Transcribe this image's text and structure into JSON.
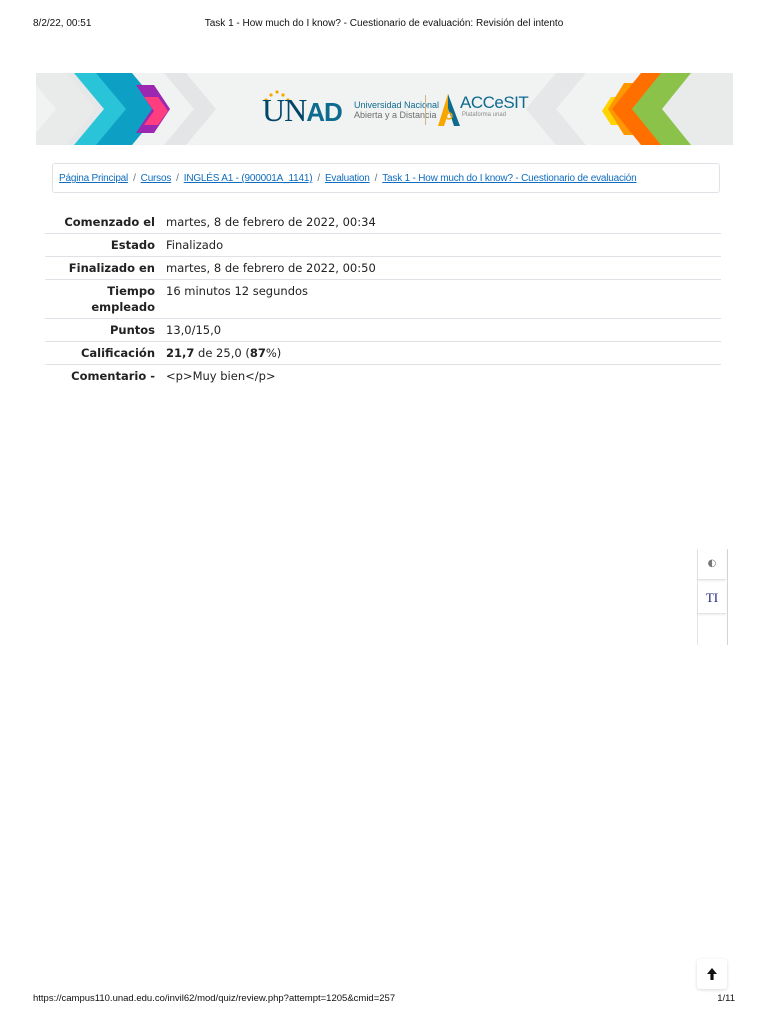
{
  "print_header": {
    "datetime": "8/2/22, 00:51",
    "page_title": "Task 1 - How much do I know? - Cuestionario de evaluación: Revisión del intento"
  },
  "banner": {
    "unad_logo_word": "UN",
    "unad_logo_bold": "AD",
    "unad_line1": "Universidad Nacional",
    "unad_line2": "Abierta y a Distancia",
    "accesit_logo_word": "ACCeSIT",
    "accesit_tagline": "Plataforma unad"
  },
  "breadcrumb": {
    "items": [
      "Página Principal",
      "Cursos",
      "INGLÉS A1 - (900001A_1141)",
      "Evaluation",
      "Task 1 - How much do I know? - Cuestionario de evaluación"
    ],
    "separator": "/"
  },
  "summary": {
    "rows": [
      {
        "label": "Comenzado el",
        "value": "martes, 8 de febrero de 2022, 00:34"
      },
      {
        "label": "Estado",
        "value": "Finalizado"
      },
      {
        "label": "Finalizado en",
        "value": "martes, 8 de febrero de 2022, 00:50"
      },
      {
        "label": "Tiempo empleado",
        "value": "16 minutos 12 segundos"
      },
      {
        "label": "Puntos",
        "value": "13,0/15,0"
      }
    ],
    "grade": {
      "label": "Calificación",
      "score": "21,7",
      "of_text": " de 25,0 (",
      "percent": "87",
      "close_text": "%)"
    },
    "comment": {
      "label": "Comentario -",
      "value": "<p>Muy bien</p>"
    }
  },
  "widgets": {
    "contrast_glyph": "◐",
    "text_size_glyph": "TI"
  },
  "print_footer": {
    "url": "https://campus110.unad.edu.co/invil62/mod/quiz/review.php?attempt=1205&cmid=257",
    "page_indicator": "1/11"
  },
  "colors": {
    "link": "#0f6cbf",
    "unad_blue": "#004669",
    "banner_bg": "#f1f2f2"
  }
}
